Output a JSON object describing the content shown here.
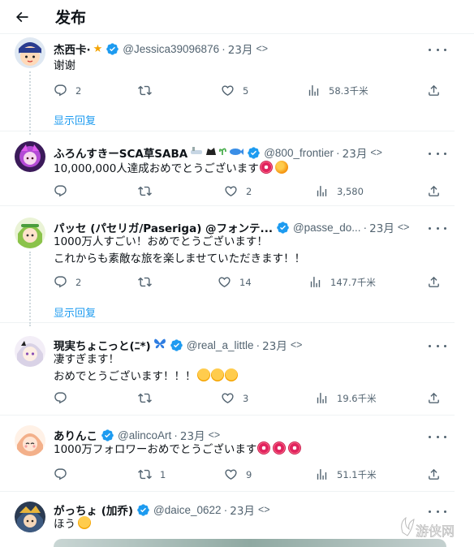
{
  "header": {
    "title": "发布"
  },
  "tweets": [
    {
      "name": "杰西卡·",
      "name_emoji": "★",
      "handle": "@Jessica39096876",
      "time": "23月",
      "edit": "<>",
      "text_lines": [
        "谢谢"
      ],
      "reply_count": "2",
      "retweet_count": "",
      "like_count": "5",
      "views": "58.3千米",
      "show_replies": "显示回复"
    },
    {
      "name": "ふろんすきーSCA草SABA",
      "name_emoji": "🛁🐈🌱🐟",
      "handle": "@800_frontier",
      "time": "23月",
      "edit": "<>",
      "text_lines": [
        "10,000,000人達成おめでとうございます"
      ],
      "reply_count": "",
      "retweet_count": "",
      "like_count": "2",
      "views": "3,580"
    },
    {
      "name": "パッセ (パセリガ/Paseriga) @フォンテ...",
      "name_emoji": "",
      "handle": "@passe_do...",
      "time": "23月",
      "edit": "<>",
      "text_lines": [
        "1000万人すごい！おめでとうございます！",
        "これからも素敵な旅を楽しませていただきます！！"
      ],
      "reply_count": "2",
      "retweet_count": "",
      "like_count": "14",
      "views": "147.7千米",
      "show_replies": "显示回复"
    },
    {
      "name": "現実ちょこっと(ﾆ*)",
      "name_emoji": "🦋",
      "handle": "@real_a_little",
      "time": "23月",
      "edit": "<>",
      "text_lines": [
        "凄すぎます！",
        "おめでとうございます！！！"
      ],
      "reply_count": "",
      "retweet_count": "",
      "like_count": "3",
      "views": "19.6千米"
    },
    {
      "name": "ありんこ",
      "name_emoji": "",
      "handle": "@alincoArt",
      "time": "23月",
      "edit": "<>",
      "text_lines": [
        "1000万フォロワーおめでとうございます"
      ],
      "reply_count": "",
      "retweet_count": "1",
      "like_count": "9",
      "views": "51.1千米"
    },
    {
      "name": "がっちょ (加乔)",
      "name_emoji": "",
      "handle": "@daice_0622",
      "time": "23月",
      "edit": "<>",
      "text_lines": [
        "ほう"
      ]
    }
  ],
  "watermark": {
    "text": "游侠网"
  },
  "icons": {
    "back": "arrow-left-icon",
    "verified": "verified-badge-icon",
    "reply": "reply-icon",
    "retweet": "retweet-icon",
    "like": "heart-icon",
    "views": "views-icon",
    "share": "share-icon",
    "more": "more-icon"
  },
  "colors": {
    "accent": "#1d9bf0",
    "muted": "#536471",
    "text": "#0f1419",
    "divider": "#eff3f4"
  }
}
